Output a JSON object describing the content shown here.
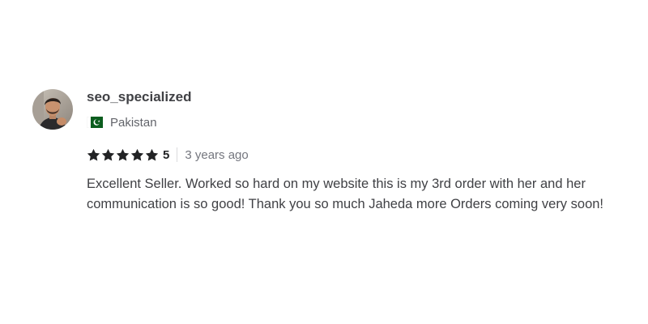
{
  "review": {
    "username": "seo_specialized",
    "country": "Pakistan",
    "flag_icon": "pakistan-flag-icon",
    "rating": "5",
    "stars_filled": 5,
    "stars_total": 5,
    "star_color": "#222325",
    "time_ago": "3 years ago",
    "text": "Excellent Seller. Worked so hard on my website this is my 3rd order with her and her communication is so good! Thank you so much Jaheda more Orders coming very soon!"
  }
}
